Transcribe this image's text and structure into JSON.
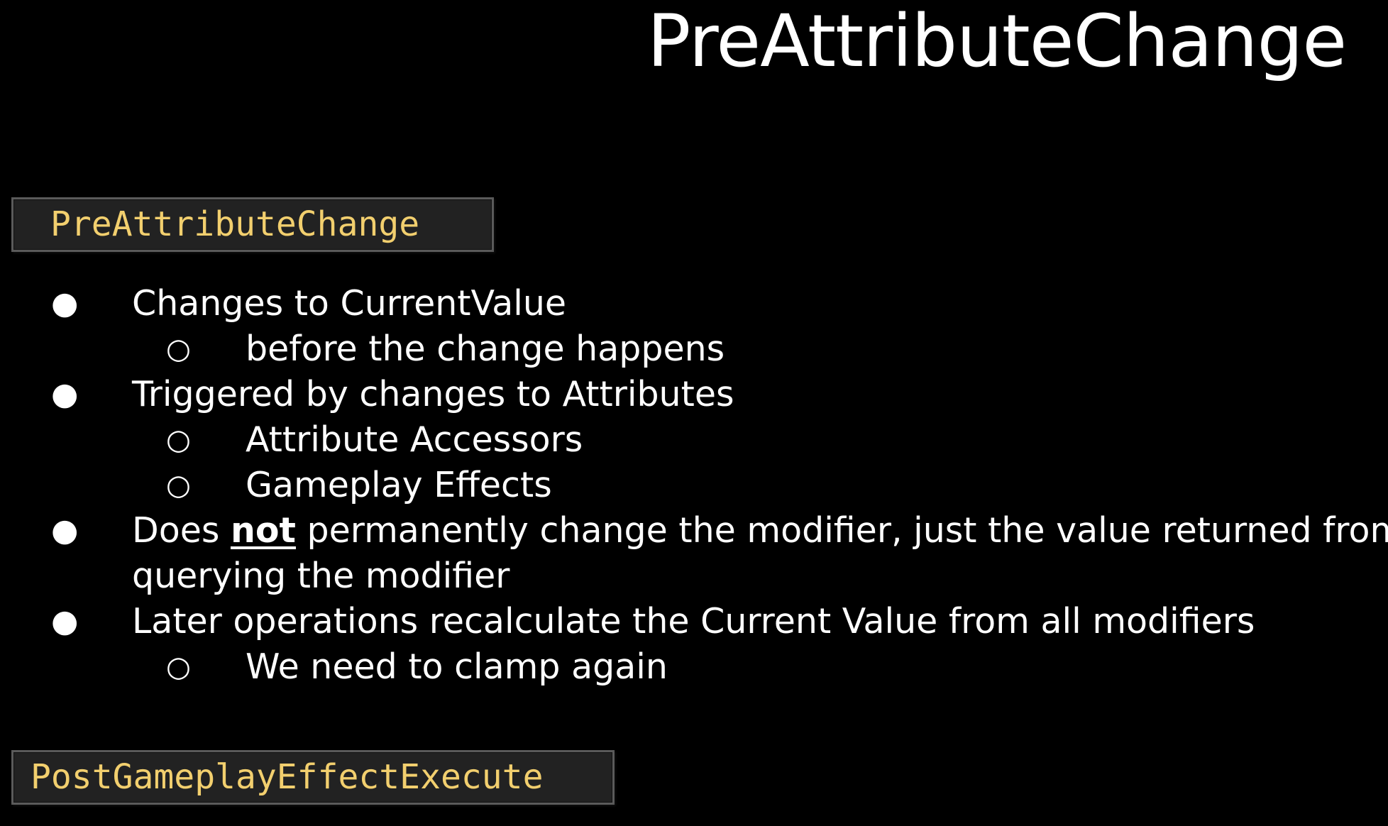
{
  "slide": {
    "title": "PreAttributeChange",
    "code_top": "PreAttributeChange",
    "code_bottom": "PostGameplayEffectExecute",
    "bullet_marker": "●",
    "sub_marker": "○",
    "items": {
      "b1": "Changes to CurrentValue",
      "b1_s1": "before the change happens",
      "b2": "Triggered by changes to Attributes",
      "b2_s1": "Attribute Accessors",
      "b2_s2": "Gameplay Effects",
      "b3_pre": "Does ",
      "b3_emph": "not",
      "b3_post": " permanently change the modifier, just the value returned from",
      "b3_cont": "querying the modifier",
      "b4": "Later operations recalculate the Current Value from all modifiers",
      "b4_s1": "We need to clamp again"
    }
  }
}
